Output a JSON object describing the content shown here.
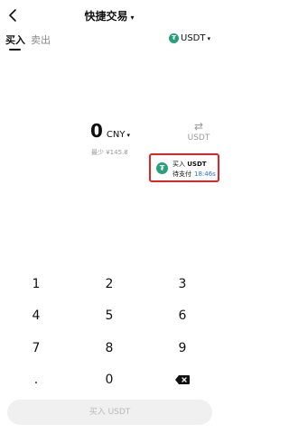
{
  "nav": {
    "title": "快捷交易",
    "title_caret": "▾",
    "back_icon": "chevron-left-icon"
  },
  "tabs": [
    {
      "label": "买入",
      "active": true
    },
    {
      "label": "卖出",
      "active": false
    }
  ],
  "asset_selector": {
    "icon": "tether-icon",
    "icon_glyph": "₮",
    "label": "USDT",
    "caret": "▾"
  },
  "amount": {
    "value": "0",
    "currency": "CNY",
    "caret": "▾",
    "min_note": "最少 ¥145.8"
  },
  "swap": {
    "icon_glyph": "⇄",
    "label": "USDT"
  },
  "order_popup": {
    "icon_glyph": "₮",
    "action": "买入",
    "asset": "USDT",
    "status": "待支付",
    "countdown": "18:46s"
  },
  "keypad": {
    "keys": [
      "1",
      "2",
      "3",
      "4",
      "5",
      "6",
      "7",
      "8",
      "9",
      ".",
      "0"
    ]
  },
  "buy_button": {
    "label": "买入 USDT"
  },
  "colors": {
    "tether": "#26a17b",
    "highlight_border": "#e02424",
    "countdown": "#2b6fd8",
    "disabled_button_bg": "#f0f0f0"
  }
}
